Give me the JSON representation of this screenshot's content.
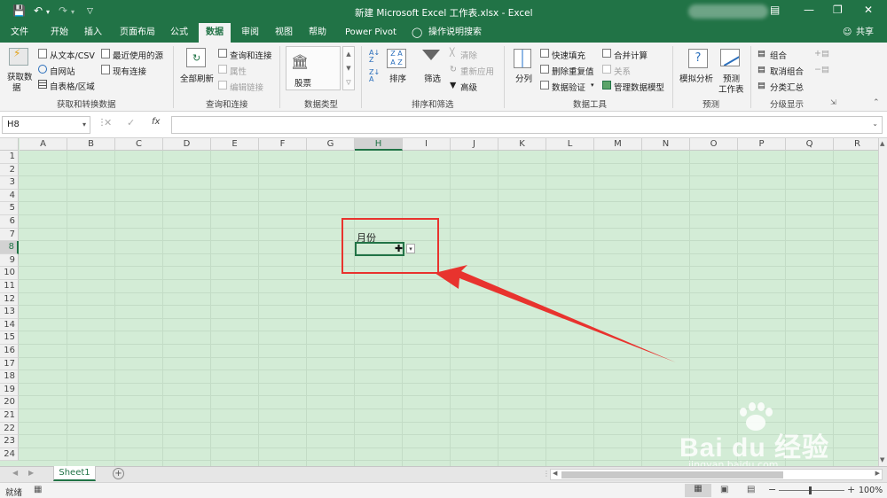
{
  "titlebar": {
    "title": "新建 Microsoft Excel 工作表.xlsx  -  Excel",
    "qat_icons": [
      "save-icon",
      "undo-icon",
      "redo-icon",
      "customize-icon"
    ],
    "window_icons": [
      "ribbon-options-icon",
      "minimize-icon",
      "restore-icon",
      "close-icon"
    ]
  },
  "tabs": [
    "文件",
    "开始",
    "插入",
    "页面布局",
    "公式",
    "数据",
    "审阅",
    "视图",
    "帮助",
    "Power Pivot"
  ],
  "active_tab": "数据",
  "tell_me": "操作说明搜索",
  "share": "共享",
  "ribbon": {
    "get_transform": {
      "get_data_line1": "获取数",
      "get_data_line2": "据",
      "from_text_csv": "从文本/CSV",
      "from_web": "自网站",
      "from_table": "自表格/区域",
      "recent_sources": "最近使用的源",
      "existing_connections": "现有连接",
      "label": "获取和转换数据"
    },
    "queries": {
      "refresh_all": "全部刷新",
      "queries_connections": "查询和连接",
      "properties": "属性",
      "edit_links": "编辑链接",
      "label": "查询和连接"
    },
    "data_types": {
      "stocks": "股票",
      "label": "数据类型"
    },
    "sort_filter": {
      "sort": "排序",
      "filter": "筛选",
      "clear": "清除",
      "reapply": "重新应用",
      "advanced": "高级",
      "label": "排序和筛选"
    },
    "data_tools": {
      "text_to_columns": "分列",
      "flash_fill": "快速填充",
      "remove_duplicates": "删除重复值",
      "data_validation": "数据验证",
      "consolidate": "合并计算",
      "relationships": "关系",
      "manage_data_model": "管理数据模型",
      "label": "数据工具"
    },
    "forecast": {
      "what_if": "模拟分析",
      "forecast_sheet_line1": "预测",
      "forecast_sheet_line2": "工作表",
      "label": "预测"
    },
    "outline": {
      "group": "组合",
      "ungroup": "取消组合",
      "subtotal": "分类汇总",
      "label": "分级显示"
    }
  },
  "formula_bar": {
    "name_box": "H8",
    "fx": "fx",
    "content": ""
  },
  "columns": [
    "A",
    "B",
    "C",
    "D",
    "E",
    "F",
    "G",
    "H",
    "I",
    "J",
    "K",
    "L",
    "M",
    "N",
    "O",
    "P",
    "Q",
    "R"
  ],
  "rows": [
    "1",
    "2",
    "3",
    "4",
    "5",
    "6",
    "7",
    "8",
    "9",
    "10",
    "11",
    "12",
    "13",
    "14",
    "15",
    "16",
    "17",
    "18",
    "19",
    "20",
    "21",
    "22",
    "23",
    "24"
  ],
  "selected_cell": "H8",
  "cells": {
    "H7": "月份"
  },
  "sheet_tabs": [
    "Sheet1"
  ],
  "status": {
    "ready": "就绪",
    "zoom": "100%"
  },
  "watermark": {
    "brand": "Bai du 经验",
    "url": "jingyan.baidu.com"
  },
  "colors": {
    "excel_green": "#217346",
    "grid_bg": "#d3ecd6",
    "highlight_red": "#e8332e"
  }
}
